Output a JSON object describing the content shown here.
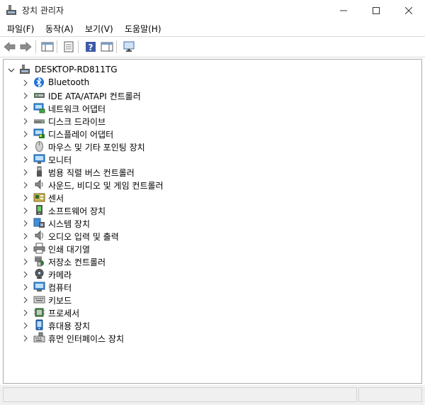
{
  "window": {
    "title": "장치 관리자"
  },
  "menu": [
    {
      "label": "파일(F)"
    },
    {
      "label": "동작(A)"
    },
    {
      "label": "보기(V)"
    },
    {
      "label": "도움말(H)"
    }
  ],
  "tree": {
    "root": "DESKTOP-RD811TG",
    "categories": [
      {
        "label": "Bluetooth",
        "icon": "bluetooth-icon"
      },
      {
        "label": "IDE ATA/ATAPI 컨트롤러",
        "icon": "ide-controller-icon"
      },
      {
        "label": "네트워크 어댑터",
        "icon": "network-adapter-icon"
      },
      {
        "label": "디스크 드라이브",
        "icon": "disk-drive-icon"
      },
      {
        "label": "디스플레이 어댑터",
        "icon": "display-adapter-icon"
      },
      {
        "label": "마우스 및 기타 포인팅 장치",
        "icon": "mouse-icon"
      },
      {
        "label": "모니터",
        "icon": "monitor-icon"
      },
      {
        "label": "범용 직렬 버스 컨트롤러",
        "icon": "usb-icon"
      },
      {
        "label": "사운드, 비디오 및 게임 컨트롤러",
        "icon": "speaker-icon"
      },
      {
        "label": "센서",
        "icon": "sensor-icon"
      },
      {
        "label": "소프트웨어 장치",
        "icon": "software-device-icon"
      },
      {
        "label": "시스템 장치",
        "icon": "system-device-icon"
      },
      {
        "label": "오디오 입력 및 출력",
        "icon": "audio-icon"
      },
      {
        "label": "인쇄 대기열",
        "icon": "printer-icon"
      },
      {
        "label": "저장소 컨트롤러",
        "icon": "storage-controller-icon"
      },
      {
        "label": "카메라",
        "icon": "camera-icon"
      },
      {
        "label": "컴퓨터",
        "icon": "computer-icon"
      },
      {
        "label": "키보드",
        "icon": "keyboard-icon"
      },
      {
        "label": "프로세서",
        "icon": "processor-icon"
      },
      {
        "label": "휴대용 장치",
        "icon": "portable-device-icon"
      },
      {
        "label": "휴먼 인터페이스 장치",
        "icon": "hid-icon"
      }
    ]
  }
}
